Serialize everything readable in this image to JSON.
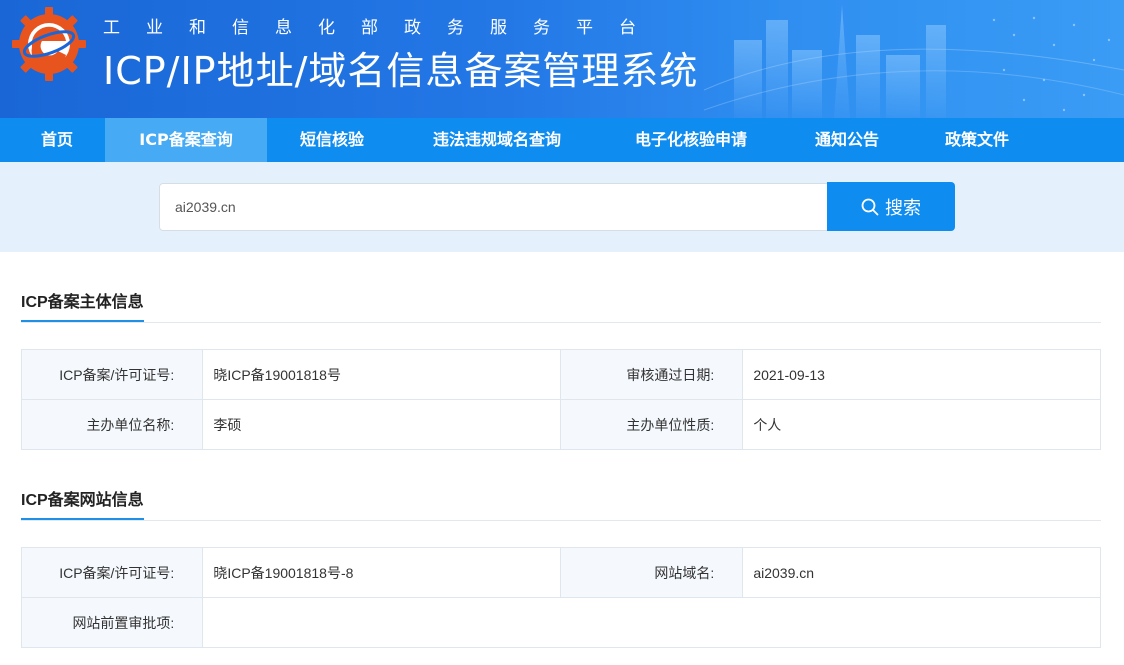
{
  "header": {
    "subtitle": "工业和信息化部政务服务平台",
    "title": "ICP/IP地址/域名信息备案管理系统",
    "logo_icon": "ministry-logo-icon",
    "colors": {
      "banner_start": "#1a66d6",
      "banner_end": "#3a9cf5"
    }
  },
  "nav": {
    "items": [
      {
        "label": "首页"
      },
      {
        "label": "ICP备案查询",
        "active": true
      },
      {
        "label": "短信核验"
      },
      {
        "label": "违法违规域名查询"
      },
      {
        "label": "电子化核验申请"
      },
      {
        "label": "通知公告"
      },
      {
        "label": "政策文件"
      }
    ],
    "colors": {
      "bar": "#0f8cf0",
      "active": "#46aaf5"
    }
  },
  "search": {
    "value": "ai2039.cn",
    "button_label": "搜索",
    "button_icon": "search-icon"
  },
  "subject_section": {
    "title": "ICP备案主体信息",
    "rows": [
      {
        "label1": "ICP备案/许可证号:",
        "value1": "晓ICP备19001818号",
        "label2": "审核通过日期:",
        "value2": "2021-09-13"
      },
      {
        "label1": "主办单位名称:",
        "value1": "李硕",
        "label2": "主办单位性质:",
        "value2": "个人"
      }
    ]
  },
  "website_section": {
    "title": "ICP备案网站信息",
    "rows": [
      {
        "label1": "ICP备案/许可证号:",
        "value1": "晓ICP备19001818号-8",
        "label2": "网站域名:",
        "value2": "ai2039.cn"
      },
      {
        "label1": "网站前置审批项:",
        "value1": ""
      }
    ]
  }
}
